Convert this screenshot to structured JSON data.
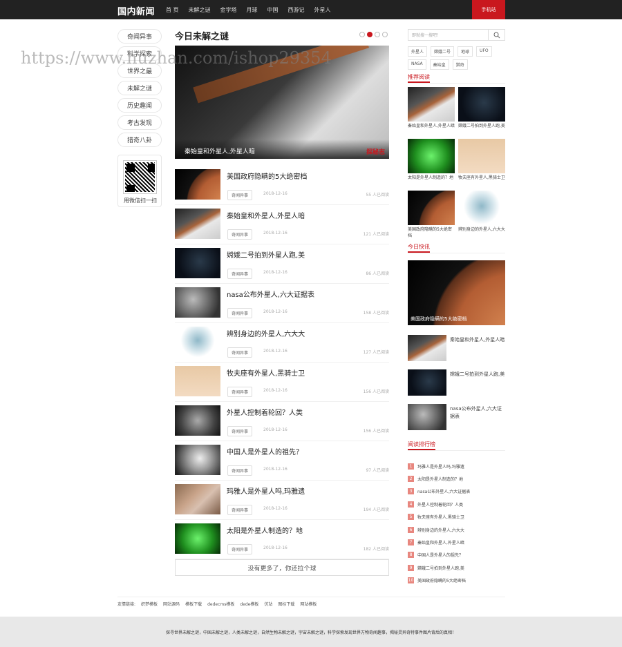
{
  "header": {
    "logo": "国内新闻",
    "nav": [
      "首 页",
      "未解之谜",
      "金字塔",
      "月球",
      "中国",
      "西游记",
      "外星人"
    ],
    "mobile_btn": "手机站"
  },
  "left_nav": [
    "奇闻异事",
    "科学探索",
    "世界之最",
    "未解之谜",
    "历史趣闻",
    "考古发现",
    "猎奇八卦"
  ],
  "qr_caption": "用微信扫一扫",
  "watermark": "https://www.huzhan.com/ishop29354",
  "main": {
    "title": "今日未解之谜",
    "hero_caption": "秦始皇和外星人,外星人暗",
    "hero_mark": "探秘志",
    "articles": [
      {
        "title": "美国政府隐瞒的5大绝密档",
        "tag": "奇闻异事",
        "date": "2018-12-16",
        "views": "55 人已阅读",
        "img": "mars"
      },
      {
        "title": "秦始皇和外星人,外星人暗",
        "tag": "奇闻异事",
        "date": "2018-12-16",
        "views": "121 人已阅读",
        "img": "rod"
      },
      {
        "title": "嫦娥二号拍到外星人跑,美",
        "tag": "奇闻异事",
        "date": "2018-12-16",
        "views": "86 人已阅读",
        "img": "night"
      },
      {
        "title": "nasa公布外星人,六大证据表",
        "tag": "奇闻异事",
        "date": "2018-12-16",
        "views": "158 人已阅读",
        "img": "moon"
      },
      {
        "title": "辨别身边的外星人,六大大",
        "tag": "奇闻异事",
        "date": "2018-12-16",
        "views": "127 人已阅读",
        "img": "alien"
      },
      {
        "title": "牧夫座有外星人,黑骑士卫",
        "tag": "奇闻异事",
        "date": "2018-12-16",
        "views": "156 人已阅读",
        "img": "sky"
      },
      {
        "title": "外星人控制着轮回？人类",
        "tag": "奇闻异事",
        "date": "2018-12-16",
        "views": "156 人已阅读",
        "img": "grey"
      },
      {
        "title": "中国人是外星人的祖先？",
        "tag": "奇闻异事",
        "date": "2018-12-16",
        "views": "97 人已阅读",
        "img": "skull"
      },
      {
        "title": "玛雅人是外星人吗,玛雅遗",
        "tag": "奇闻异事",
        "date": "2018-12-16",
        "views": "194 人已阅读",
        "img": "ruins"
      },
      {
        "title": "太阳是外星人制造的？地",
        "tag": "奇闻异事",
        "date": "2018-12-16",
        "views": "182 人已阅读",
        "img": "green"
      }
    ],
    "more": "没有更多了，你还拉个球"
  },
  "right": {
    "search_placeholder": "即就搜一搜吧！",
    "tags": [
      "外星人",
      "嫦娥二号",
      "地球",
      "UFO",
      "NASA",
      "秦始皇",
      "猎奇"
    ],
    "recommend_title": "推荐阅读",
    "recommend": [
      {
        "title": "秦始皇和外星人,外星人暗",
        "img": "rod"
      },
      {
        "title": "嫦娥二号拍到外星人跑,美",
        "img": "night"
      },
      {
        "title": "太阳是外星人制造的？地",
        "img": "green"
      },
      {
        "title": "牧夫座有外星人,黑骑士卫",
        "img": "sky"
      },
      {
        "title": "美国政府隐瞒的5大绝密档",
        "img": "mars"
      },
      {
        "title": "辨别身边的外星人,六大大",
        "img": "alien"
      }
    ],
    "kuaixun_title": "今日快讯",
    "kuaixun_big": "美国政府隐瞒的5大绝密档",
    "kuaixun": [
      {
        "title": "秦始皇和外星人,外星人暗",
        "img": "rod"
      },
      {
        "title": "嫦娥二号拍到外星人跑,美",
        "img": "night"
      },
      {
        "title": "nasa公布外星人,六大证据表",
        "img": "moon"
      }
    ],
    "rank_title": "阅读排行榜",
    "rank": [
      {
        "num": "1",
        "title": "玛雅人是外星人吗,玛雅遗"
      },
      {
        "num": "2",
        "title": "太阳是外星人制造的？地"
      },
      {
        "num": "3",
        "title": "nasa公布外星人,六大证据表"
      },
      {
        "num": "4",
        "title": "外星人控制着轮回？人类"
      },
      {
        "num": "5",
        "title": "牧夫座有外星人,黑骑士卫"
      },
      {
        "num": "6",
        "title": "辨别身边的外星人,六大大"
      },
      {
        "num": "7",
        "title": "秦始皇和外星人,外星人暗"
      },
      {
        "num": "8",
        "title": "中国人是外星人的祖先？"
      },
      {
        "num": "9",
        "title": "嫦娥二号拍到外星人跑,美"
      },
      {
        "num": "10",
        "title": "美国政府隐瞒的5大绝密档"
      }
    ]
  },
  "footer": {
    "links_label": "友情链接:",
    "links": [
      "织梦模板",
      "网站源码",
      "模板下载",
      "dedecms模板",
      "dede模板",
      "仿站",
      "图标下载",
      "网站模板"
    ],
    "copyright": "探寻世界未解之谜，中国未解之谜，人类未解之谜，自然生物未解之谜，宇宙未解之谜，科学探索发现世界万物奇闻趣事，揭秘灵异奇特事件图片背后的真相！"
  }
}
